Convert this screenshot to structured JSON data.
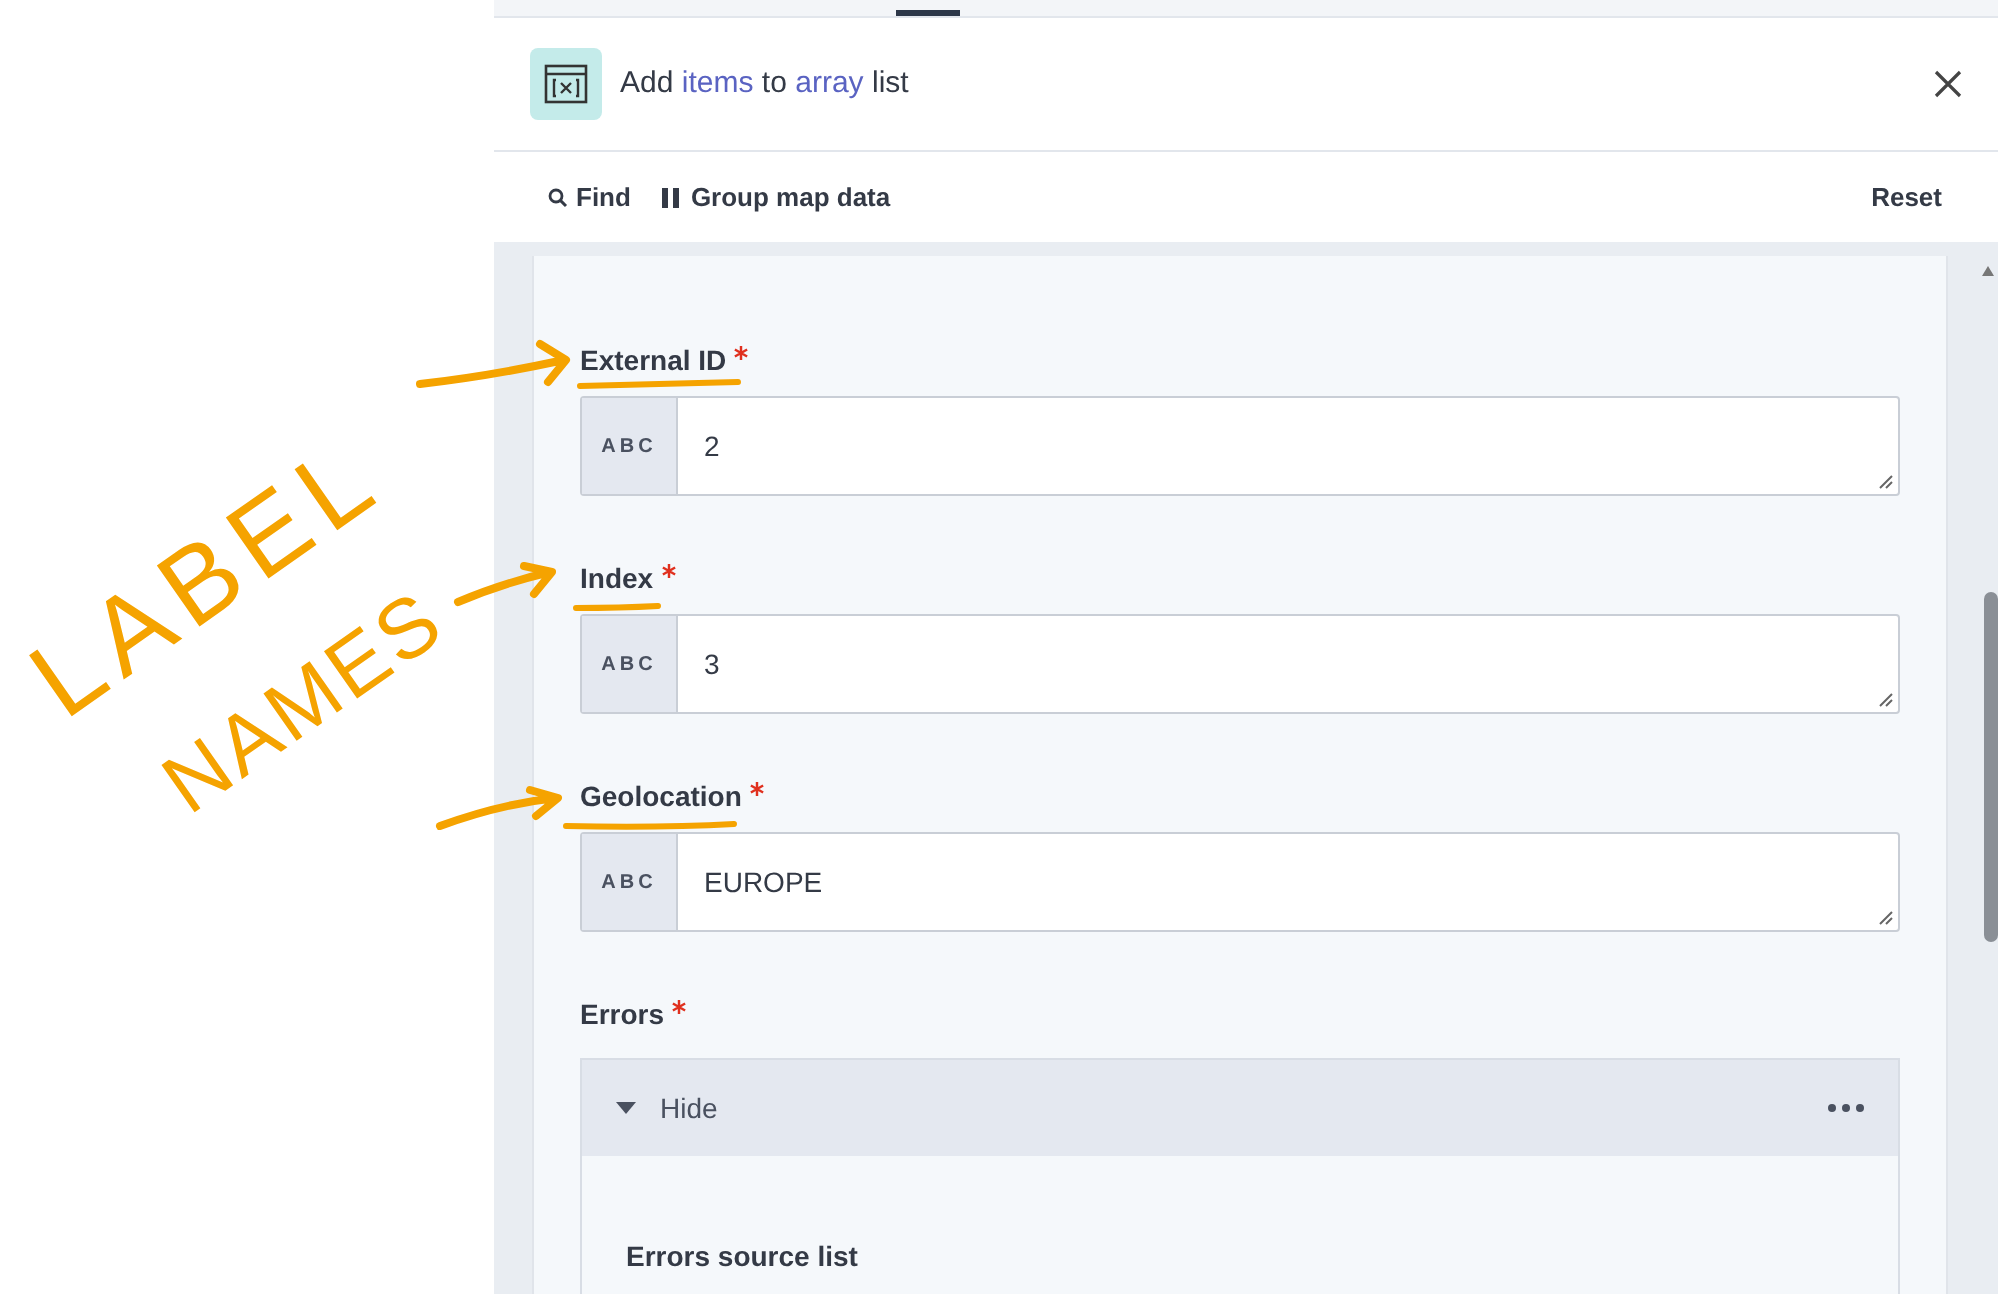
{
  "annotation": {
    "lines": [
      "LABEL",
      "NAMES"
    ]
  },
  "header": {
    "title_parts": [
      {
        "text": "Add",
        "kind": "plain"
      },
      {
        "text": "items",
        "kind": "token"
      },
      {
        "text": "to",
        "kind": "plain"
      },
      {
        "text": "array",
        "kind": "token"
      },
      {
        "text": "list",
        "kind": "plain"
      }
    ]
  },
  "toolbar": {
    "find": "Find",
    "group": "Group map data",
    "reset": "Reset"
  },
  "fields": [
    {
      "label": "External ID",
      "required": true,
      "prefix": "ABC",
      "value": "2"
    },
    {
      "label": "Index",
      "required": true,
      "prefix": "ABC",
      "value": "3"
    },
    {
      "label": "Geolocation",
      "required": true,
      "prefix": "ABC",
      "value": "EUROPE"
    }
  ],
  "errors": {
    "label": "Errors",
    "required": true,
    "toggle": "Hide",
    "expanded": true,
    "child_label": "Errors source list"
  }
}
